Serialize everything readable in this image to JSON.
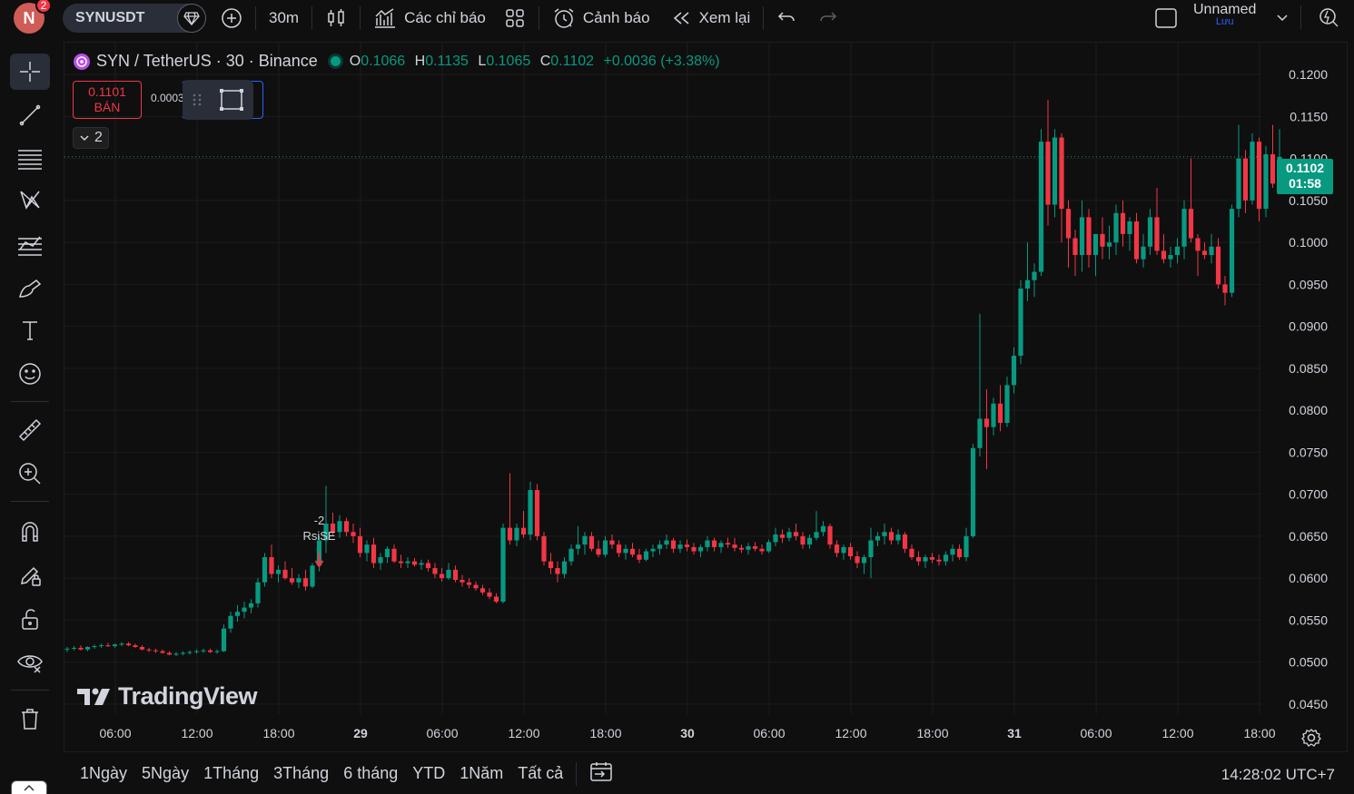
{
  "topbar": {
    "avatar_letter": "N",
    "notifications": "2",
    "symbol": "SYNUSDT",
    "interval": "30m",
    "indicators_label": "Các chỉ báo",
    "alerts_label": "Cảnh báo",
    "replay_label": "Xem lại",
    "layout_name": "Unnamed",
    "save_label": "Lưu"
  },
  "legend": {
    "title": "SYN / TetherUS · 30 · Binance",
    "o_key": "O",
    "o": "0.1066",
    "h_key": "H",
    "h": "0.1135",
    "l_key": "L",
    "l": "0.1065",
    "c_key": "C",
    "c": "0.1102",
    "change": "+0.0036 (+3.38%)"
  },
  "trade": {
    "sell_price": "0.1101",
    "sell_label": "BÁN",
    "spread": "0.0003"
  },
  "indicators_collapsed_count": "2",
  "last_price_tag": {
    "price": "0.1102",
    "countdown": "01:58"
  },
  "signal": {
    "value": "-2",
    "label": "RsiSE"
  },
  "watermark": "TradingView",
  "ranges": [
    "1Ngày",
    "5Ngày",
    "1Tháng",
    "3Tháng",
    "6 tháng",
    "YTD",
    "1Năm",
    "Tất cả"
  ],
  "clock": "14:28:02 UTC+7",
  "colors": {
    "up": "#089981",
    "down": "#f23645",
    "accent": "#2962ff"
  },
  "chart_data": {
    "type": "candlestick",
    "price_axis_ticks": [
      "0.1200",
      "0.1150",
      "0.1100",
      "0.1050",
      "0.1000",
      "0.0950",
      "0.0900",
      "0.0850",
      "0.0800",
      "0.0750",
      "0.0700",
      "0.0650",
      "0.0600",
      "0.0550",
      "0.0500",
      "0.0450"
    ],
    "time_axis_ticks": [
      "06:00",
      "12:00",
      "18:00",
      "29",
      "06:00",
      "12:00",
      "18:00",
      "30",
      "06:00",
      "12:00",
      "18:00",
      "31",
      "06:00",
      "12:00",
      "18:00"
    ],
    "ylim": [
      0.0438,
      0.1238
    ],
    "interval_minutes": 30,
    "last_price": 0.1102,
    "candles": [
      [
        0.0515,
        0.0518,
        0.0512,
        0.0516
      ],
      [
        0.0516,
        0.0519,
        0.0514,
        0.0517
      ],
      [
        0.0517,
        0.052,
        0.0514,
        0.0515
      ],
      [
        0.0515,
        0.0519,
        0.0513,
        0.0518
      ],
      [
        0.0518,
        0.0521,
        0.0516,
        0.0519
      ],
      [
        0.0519,
        0.0522,
        0.0517,
        0.052
      ],
      [
        0.052,
        0.0523,
        0.0518,
        0.0519
      ],
      [
        0.0519,
        0.0522,
        0.0517,
        0.0521
      ],
      [
        0.0521,
        0.0524,
        0.0519,
        0.0522
      ],
      [
        0.0522,
        0.0524,
        0.0519,
        0.052
      ],
      [
        0.052,
        0.0522,
        0.0517,
        0.0518
      ],
      [
        0.0518,
        0.052,
        0.0514,
        0.0515
      ],
      [
        0.0515,
        0.0517,
        0.0512,
        0.0514
      ],
      [
        0.0514,
        0.0516,
        0.0511,
        0.0513
      ],
      [
        0.0513,
        0.0515,
        0.051,
        0.0511
      ],
      [
        0.0511,
        0.0513,
        0.0508,
        0.0509
      ],
      [
        0.0509,
        0.0512,
        0.0507,
        0.051
      ],
      [
        0.051,
        0.0513,
        0.0508,
        0.0511
      ],
      [
        0.0511,
        0.0514,
        0.0509,
        0.0512
      ],
      [
        0.0512,
        0.0515,
        0.051,
        0.0513
      ],
      [
        0.0513,
        0.0516,
        0.0511,
        0.0514
      ],
      [
        0.0514,
        0.0516,
        0.0511,
        0.0512
      ],
      [
        0.0512,
        0.0515,
        0.051,
        0.0513
      ],
      [
        0.0513,
        0.0545,
        0.0512,
        0.054
      ],
      [
        0.054,
        0.056,
        0.0535,
        0.0555
      ],
      [
        0.0555,
        0.0568,
        0.0548,
        0.056
      ],
      [
        0.056,
        0.0572,
        0.0552,
        0.0565
      ],
      [
        0.0565,
        0.0575,
        0.0558,
        0.057
      ],
      [
        0.057,
        0.06,
        0.0565,
        0.0595
      ],
      [
        0.0595,
        0.063,
        0.059,
        0.0625
      ],
      [
        0.0625,
        0.064,
        0.06,
        0.0605
      ],
      [
        0.0605,
        0.0615,
        0.0595,
        0.061
      ],
      [
        0.061,
        0.062,
        0.0598,
        0.06
      ],
      [
        0.06,
        0.0612,
        0.0592,
        0.0595
      ],
      [
        0.0595,
        0.0605,
        0.0588,
        0.06
      ],
      [
        0.06,
        0.061,
        0.0585,
        0.059
      ],
      [
        0.059,
        0.0618,
        0.0588,
        0.0615
      ],
      [
        0.0615,
        0.065,
        0.0608,
        0.0645
      ],
      [
        0.0645,
        0.071,
        0.063,
        0.0665
      ],
      [
        0.0665,
        0.0678,
        0.065,
        0.0655
      ],
      [
        0.0655,
        0.0675,
        0.0648,
        0.0668
      ],
      [
        0.0668,
        0.0672,
        0.065,
        0.0655
      ],
      [
        0.0655,
        0.0665,
        0.0642,
        0.065
      ],
      [
        0.065,
        0.066,
        0.0625,
        0.063
      ],
      [
        0.063,
        0.0645,
        0.062,
        0.064
      ],
      [
        0.064,
        0.0648,
        0.0612,
        0.0618
      ],
      [
        0.0618,
        0.063,
        0.061,
        0.0625
      ],
      [
        0.0625,
        0.0638,
        0.0618,
        0.0635
      ],
      [
        0.0635,
        0.064,
        0.0618,
        0.062
      ],
      [
        0.062,
        0.0628,
        0.0612,
        0.0618
      ],
      [
        0.0618,
        0.0625,
        0.0612,
        0.062
      ],
      [
        0.062,
        0.0624,
        0.0614,
        0.0616
      ],
      [
        0.0616,
        0.0622,
        0.061,
        0.0618
      ],
      [
        0.0618,
        0.0622,
        0.0608,
        0.0612
      ],
      [
        0.0612,
        0.0618,
        0.06,
        0.0605
      ],
      [
        0.0605,
        0.0612,
        0.0596,
        0.06
      ],
      [
        0.06,
        0.0618,
        0.0598,
        0.061
      ],
      [
        0.061,
        0.0615,
        0.0595,
        0.0598
      ],
      [
        0.0598,
        0.0604,
        0.059,
        0.0595
      ],
      [
        0.0595,
        0.06,
        0.0588,
        0.0592
      ],
      [
        0.0592,
        0.0596,
        0.0585,
        0.0588
      ],
      [
        0.0588,
        0.0592,
        0.058,
        0.0583
      ],
      [
        0.0583,
        0.0588,
        0.0575,
        0.0578
      ],
      [
        0.0578,
        0.0582,
        0.057,
        0.0572
      ],
      [
        0.0572,
        0.0665,
        0.057,
        0.066
      ],
      [
        0.066,
        0.0725,
        0.064,
        0.0645
      ],
      [
        0.0645,
        0.0665,
        0.0638,
        0.066
      ],
      [
        0.066,
        0.068,
        0.0648,
        0.0652
      ],
      [
        0.0652,
        0.0715,
        0.0645,
        0.0705
      ],
      [
        0.0705,
        0.0712,
        0.0645,
        0.065
      ],
      [
        0.065,
        0.0655,
        0.0615,
        0.062
      ],
      [
        0.062,
        0.063,
        0.0605,
        0.0612
      ],
      [
        0.0612,
        0.062,
        0.0595,
        0.0605
      ],
      [
        0.0605,
        0.0625,
        0.06,
        0.062
      ],
      [
        0.062,
        0.064,
        0.0615,
        0.0635
      ],
      [
        0.0635,
        0.0662,
        0.0628,
        0.064
      ],
      [
        0.064,
        0.0655,
        0.0628,
        0.065
      ],
      [
        0.065,
        0.0655,
        0.0632,
        0.0635
      ],
      [
        0.0635,
        0.0645,
        0.0625,
        0.0628
      ],
      [
        0.0628,
        0.065,
        0.0625,
        0.0645
      ],
      [
        0.0645,
        0.0652,
        0.0635,
        0.064
      ],
      [
        0.064,
        0.0645,
        0.0625,
        0.063
      ],
      [
        0.063,
        0.064,
        0.0622,
        0.0635
      ],
      [
        0.0635,
        0.0642,
        0.0625,
        0.0628
      ],
      [
        0.0628,
        0.0635,
        0.0618,
        0.0622
      ],
      [
        0.0622,
        0.0635,
        0.062,
        0.0632
      ],
      [
        0.0632,
        0.064,
        0.0625,
        0.0635
      ],
      [
        0.0635,
        0.0645,
        0.0628,
        0.064
      ],
      [
        0.064,
        0.0652,
        0.0635,
        0.0645
      ],
      [
        0.0645,
        0.0648,
        0.063,
        0.0635
      ],
      [
        0.0635,
        0.0645,
        0.063,
        0.064
      ],
      [
        0.064,
        0.0646,
        0.0632,
        0.0637
      ],
      [
        0.0637,
        0.0642,
        0.0628,
        0.0632
      ],
      [
        0.0632,
        0.064,
        0.0625,
        0.0637
      ],
      [
        0.0637,
        0.065,
        0.0632,
        0.0645
      ],
      [
        0.0645,
        0.0648,
        0.0632,
        0.0637
      ],
      [
        0.0637,
        0.0645,
        0.063,
        0.0642
      ],
      [
        0.0642,
        0.0648,
        0.0636,
        0.064
      ],
      [
        0.064,
        0.0648,
        0.0632,
        0.0636
      ],
      [
        0.0636,
        0.064,
        0.063,
        0.0634
      ],
      [
        0.0634,
        0.0642,
        0.0628,
        0.0638
      ],
      [
        0.0638,
        0.0643,
        0.0632,
        0.0635
      ],
      [
        0.0635,
        0.064,
        0.0628,
        0.0632
      ],
      [
        0.0632,
        0.0646,
        0.063,
        0.0643
      ],
      [
        0.0643,
        0.066,
        0.0638,
        0.0652
      ],
      [
        0.0652,
        0.0658,
        0.0642,
        0.0648
      ],
      [
        0.0648,
        0.066,
        0.0644,
        0.0655
      ],
      [
        0.0655,
        0.0665,
        0.0645,
        0.065
      ],
      [
        0.065,
        0.0655,
        0.0635,
        0.064
      ],
      [
        0.064,
        0.0652,
        0.0635,
        0.0648
      ],
      [
        0.0648,
        0.068,
        0.0645,
        0.0655
      ],
      [
        0.0655,
        0.0668,
        0.065,
        0.0662
      ],
      [
        0.0662,
        0.0665,
        0.0635,
        0.064
      ],
      [
        0.064,
        0.0645,
        0.0625,
        0.063
      ],
      [
        0.063,
        0.064,
        0.0622,
        0.0637
      ],
      [
        0.0637,
        0.0642,
        0.0622,
        0.0626
      ],
      [
        0.0626,
        0.0632,
        0.0612,
        0.0618
      ],
      [
        0.0618,
        0.0628,
        0.0605,
        0.0625
      ],
      [
        0.0625,
        0.066,
        0.06,
        0.0645
      ],
      [
        0.0645,
        0.0655,
        0.0638,
        0.065
      ],
      [
        0.065,
        0.0665,
        0.064,
        0.0655
      ],
      [
        0.0655,
        0.066,
        0.064,
        0.0645
      ],
      [
        0.0645,
        0.0658,
        0.064,
        0.0652
      ],
      [
        0.0652,
        0.0655,
        0.063,
        0.0635
      ],
      [
        0.0635,
        0.064,
        0.0622,
        0.0625
      ],
      [
        0.0625,
        0.0632,
        0.0615,
        0.062
      ],
      [
        0.062,
        0.0628,
        0.0612,
        0.0625
      ],
      [
        0.0625,
        0.063,
        0.0618,
        0.0622
      ],
      [
        0.0622,
        0.0628,
        0.0615,
        0.062
      ],
      [
        0.062,
        0.0632,
        0.0615,
        0.0628
      ],
      [
        0.0628,
        0.064,
        0.062,
        0.0635
      ],
      [
        0.0635,
        0.064,
        0.0622,
        0.0625
      ],
      [
        0.0625,
        0.066,
        0.062,
        0.065
      ],
      [
        0.065,
        0.076,
        0.0648,
        0.0755
      ],
      [
        0.0755,
        0.0915,
        0.0745,
        0.079
      ],
      [
        0.079,
        0.0825,
        0.073,
        0.078
      ],
      [
        0.078,
        0.0815,
        0.077,
        0.0808
      ],
      [
        0.0808,
        0.083,
        0.0775,
        0.0785
      ],
      [
        0.0785,
        0.084,
        0.078,
        0.083
      ],
      [
        0.083,
        0.0875,
        0.082,
        0.0865
      ],
      [
        0.0865,
        0.0955,
        0.0855,
        0.0945
      ],
      [
        0.0945,
        0.1,
        0.093,
        0.0955
      ],
      [
        0.0955,
        0.0975,
        0.0935,
        0.0965
      ],
      [
        0.0965,
        0.1135,
        0.096,
        0.112
      ],
      [
        0.112,
        0.117,
        0.102,
        0.1045
      ],
      [
        0.1045,
        0.1135,
        0.103,
        0.1125
      ],
      [
        0.1125,
        0.113,
        0.1,
        0.104
      ],
      [
        0.104,
        0.105,
        0.097,
        0.1005
      ],
      [
        0.1005,
        0.1015,
        0.096,
        0.0985
      ],
      [
        0.0985,
        0.105,
        0.0965,
        0.103
      ],
      [
        0.103,
        0.104,
        0.097,
        0.0985
      ],
      [
        0.0985,
        0.1,
        0.096,
        0.101
      ],
      [
        0.101,
        0.103,
        0.098,
        0.0995
      ],
      [
        0.0995,
        0.102,
        0.098,
        0.1
      ],
      [
        0.1,
        0.1045,
        0.0985,
        0.1035
      ],
      [
        0.1035,
        0.105,
        0.0995,
        0.101
      ],
      [
        0.101,
        0.103,
        0.099,
        0.1025
      ],
      [
        0.1025,
        0.1035,
        0.0975,
        0.098
      ],
      [
        0.098,
        0.101,
        0.097,
        0.0995
      ],
      [
        0.0995,
        0.104,
        0.0985,
        0.103
      ],
      [
        0.103,
        0.1065,
        0.0985,
        0.099
      ],
      [
        0.099,
        0.101,
        0.0975,
        0.098
      ],
      [
        0.098,
        0.0995,
        0.097,
        0.0985
      ],
      [
        0.0985,
        0.1005,
        0.0975,
        0.0995
      ],
      [
        0.0995,
        0.105,
        0.098,
        0.104
      ],
      [
        0.104,
        0.11,
        0.1,
        0.1005
      ],
      [
        0.1005,
        0.101,
        0.096,
        0.099
      ],
      [
        0.099,
        0.1,
        0.098,
        0.0985
      ],
      [
        0.0985,
        0.101,
        0.0975,
        0.0995
      ],
      [
        0.0995,
        0.1005,
        0.0945,
        0.095
      ],
      [
        0.095,
        0.096,
        0.0925,
        0.094
      ],
      [
        0.094,
        0.1045,
        0.0935,
        0.104
      ],
      [
        0.104,
        0.114,
        0.103,
        0.11
      ],
      [
        0.11,
        0.111,
        0.1035,
        0.105
      ],
      [
        0.105,
        0.113,
        0.1045,
        0.112
      ],
      [
        0.112,
        0.1125,
        0.1025,
        0.104
      ],
      [
        0.104,
        0.1115,
        0.103,
        0.1105
      ],
      [
        0.1105,
        0.114,
        0.1065,
        0.107
      ],
      [
        0.1066,
        0.1135,
        0.1065,
        0.1102
      ]
    ]
  }
}
